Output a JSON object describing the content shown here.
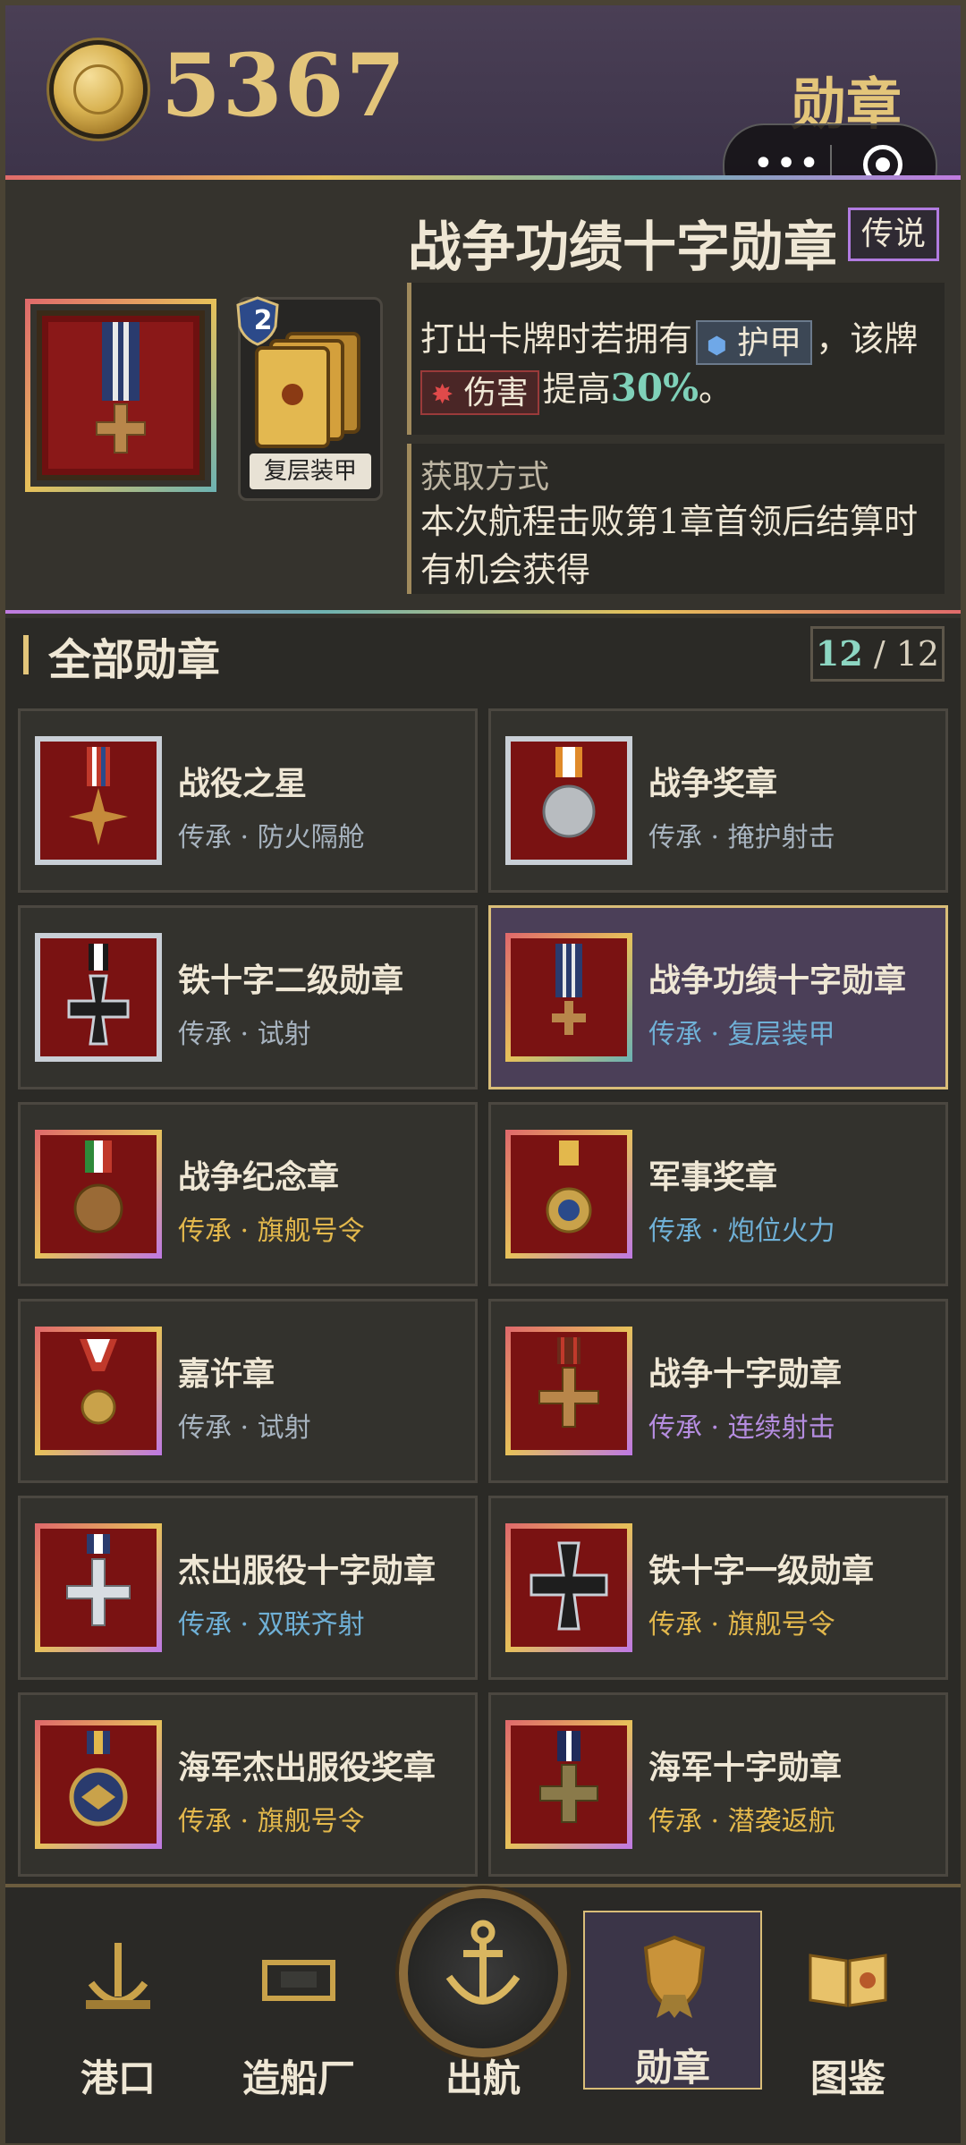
{
  "header": {
    "coins": "5367",
    "title": "勋章"
  },
  "colors": {
    "gold": "#e3c57a",
    "legend_purple": "#b17be0",
    "selected_bg": "#4b3f58"
  },
  "detail": {
    "name": "战争功绩十字勋章",
    "rarity": "传说",
    "card": {
      "level": "2",
      "label": "复层装甲"
    },
    "effect": {
      "pre": "打出卡牌时若拥有",
      "armor_kw": "护甲",
      "mid": "，该牌",
      "damage_kw": "伤害",
      "post": "提高",
      "percent": "30%",
      "end": "。"
    },
    "acquire_title": "获取方式",
    "acquire_text": "本次航程击败第1章首领后结算时有机会获得"
  },
  "section": {
    "title": "全部勋章",
    "count_current": "12",
    "count_sep": " / ",
    "count_total": "12"
  },
  "medals": [
    {
      "name": "战役之星",
      "sub": "传承 · 防火隔舱"
    },
    {
      "name": "战争奖章",
      "sub": "传承 · 掩护射击"
    },
    {
      "name": "铁十字二级勋章",
      "sub": "传承 · 试射"
    },
    {
      "name": "战争功绩十字勋章",
      "sub": "传承 · 复层装甲"
    },
    {
      "name": "战争纪念章",
      "sub": "传承 · 旗舰号令"
    },
    {
      "name": "军事奖章",
      "sub": "传承 · 炮位火力"
    },
    {
      "name": "嘉许章",
      "sub": "传承 · 试射"
    },
    {
      "name": "战争十字勋章",
      "sub": "传承 · 连续射击"
    },
    {
      "name": "杰出服役十字勋章",
      "sub": "传承 · 双联齐射"
    },
    {
      "name": "铁十字一级勋章",
      "sub": "传承 · 旗舰号令"
    },
    {
      "name": "海军杰出服役奖章",
      "sub": "传承 · 旗舰号令"
    },
    {
      "name": "海军十字勋章",
      "sub": "传承 · 潜袭返航"
    }
  ],
  "nav": [
    {
      "label": "港口",
      "icon": "harbor-icon"
    },
    {
      "label": "造船厂",
      "icon": "shipyard-icon"
    },
    {
      "label": "出航",
      "icon": "anchor-icon"
    },
    {
      "label": "勋章",
      "icon": "medal-icon"
    },
    {
      "label": "图鉴",
      "icon": "book-icon"
    }
  ]
}
